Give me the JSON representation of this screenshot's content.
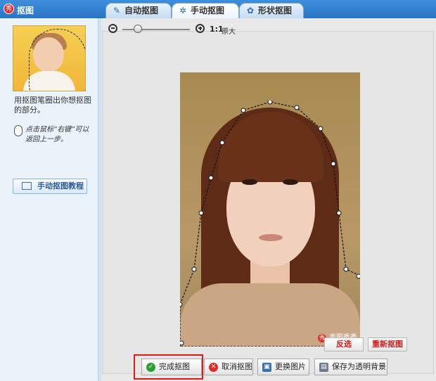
{
  "window": {
    "title": "抠图",
    "logo_text": "秀"
  },
  "tabs": [
    {
      "label": "自动抠图",
      "active": false
    },
    {
      "label": "手动抠图",
      "active": true
    },
    {
      "label": "形状抠图",
      "active": false
    }
  ],
  "sidebar": {
    "hint": "用抠图笔圈出你想抠图的部分。",
    "mouse_hint": "点击鼠标“右键”可以返回上一步。",
    "tutorial_button": "手动抠图教程"
  },
  "zoom": {
    "ratio": "1:1",
    "ratio_label": "原大",
    "slider_value": 0.15
  },
  "photo": {
    "watermark": "美图秀秀",
    "watermark_logo": "秀"
  },
  "actions": {
    "invert": "反选",
    "redo": "重新抠图"
  },
  "bottom_buttons": {
    "done": "完成抠图",
    "cancel": "取消抠图",
    "replace": "更换图片",
    "save_transparent": "保存为透明背景"
  },
  "colors": {
    "accent_red": "#d41a1a",
    "title_blue": "#2a74c6",
    "highlight": "#e01818"
  }
}
